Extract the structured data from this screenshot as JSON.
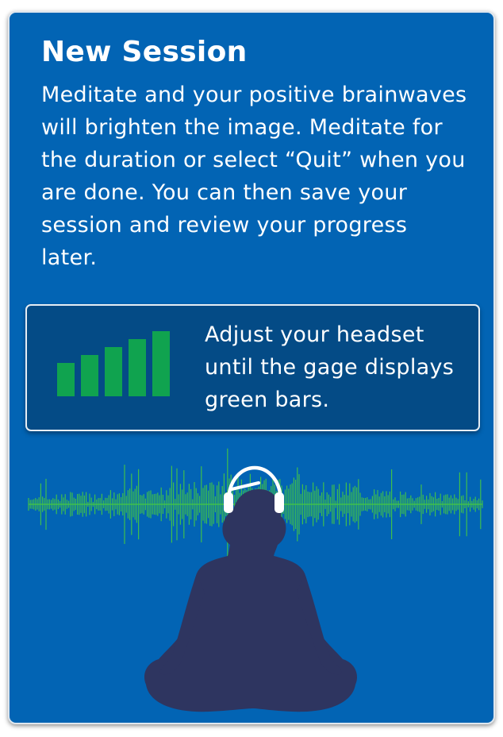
{
  "screen": {
    "title": "New Session",
    "description": "Meditate and your positive brainwaves will brighten the image. Meditate for the duration or select “Quit” when you are done. You can then save your session and review your progress later."
  },
  "headset_status": {
    "instruction": "Adjust your headset until the gage displays green bars.",
    "signal_bars_lit": 5,
    "signal_bars_total": 5,
    "bar_color": "#10a34f"
  },
  "illustration": {
    "icon": "meditating-person-with-headphones",
    "wave_color": "#3fbf4d",
    "silhouette_color": "#2e3560",
    "headphone_color": "#ffffff"
  },
  "colors": {
    "background": "#0264b4",
    "panel": "#044b86",
    "text": "#ffffff"
  }
}
